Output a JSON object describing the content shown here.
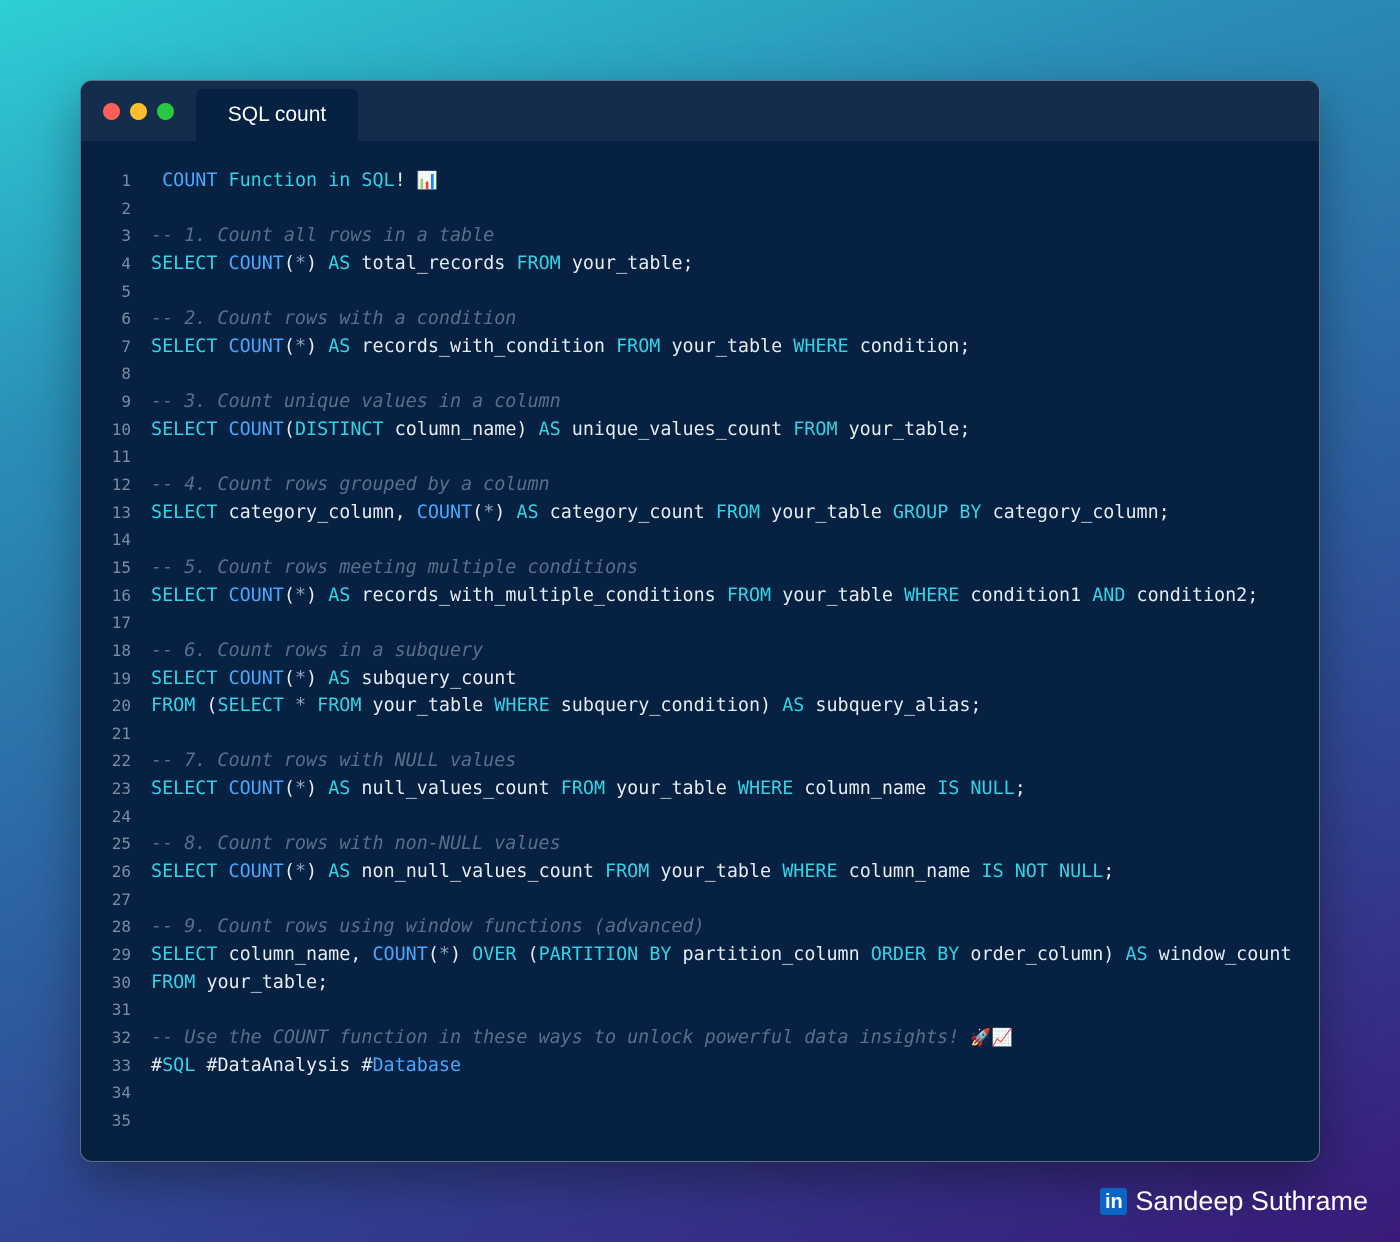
{
  "window": {
    "tab_title": "SQL count",
    "controls": [
      "close",
      "minimize",
      "zoom"
    ]
  },
  "colors": {
    "keyword": "#34d3e6",
    "function": "#4aa8ff",
    "comment": "#58708c",
    "identifier": "#e6edf3",
    "operator": "#8ea1b8",
    "editor_bg": "#072142",
    "titlebar_bg": "#142d4d"
  },
  "code": {
    "lines": [
      {
        "n": "1",
        "tokens": [
          {
            "t": " ",
            "c": "id"
          },
          {
            "t": "COUNT",
            "c": "fn"
          },
          {
            "t": " Function in SQL",
            "c": "kw"
          },
          {
            "t": "! ",
            "c": "id"
          },
          {
            "t": "📊",
            "c": "emoji"
          }
        ]
      },
      {
        "n": "2",
        "tokens": []
      },
      {
        "n": "3",
        "tokens": [
          {
            "t": "-- 1. Count all rows in a table",
            "c": "cm"
          }
        ]
      },
      {
        "n": "4",
        "tokens": [
          {
            "t": "SELECT ",
            "c": "kw"
          },
          {
            "t": "COUNT",
            "c": "fn"
          },
          {
            "t": "(",
            "c": "id"
          },
          {
            "t": "*",
            "c": "op"
          },
          {
            "t": ") ",
            "c": "id"
          },
          {
            "t": "AS ",
            "c": "kw"
          },
          {
            "t": "total_records ",
            "c": "id"
          },
          {
            "t": "FROM ",
            "c": "kw"
          },
          {
            "t": "your_table;",
            "c": "id"
          }
        ]
      },
      {
        "n": "5",
        "tokens": []
      },
      {
        "n": "6",
        "tokens": [
          {
            "t": "-- 2. Count rows with a condition",
            "c": "cm"
          }
        ]
      },
      {
        "n": "7",
        "tokens": [
          {
            "t": "SELECT ",
            "c": "kw"
          },
          {
            "t": "COUNT",
            "c": "fn"
          },
          {
            "t": "(",
            "c": "id"
          },
          {
            "t": "*",
            "c": "op"
          },
          {
            "t": ") ",
            "c": "id"
          },
          {
            "t": "AS ",
            "c": "kw"
          },
          {
            "t": "records_with_condition ",
            "c": "id"
          },
          {
            "t": "FROM ",
            "c": "kw"
          },
          {
            "t": "your_table ",
            "c": "id"
          },
          {
            "t": "WHERE ",
            "c": "kw"
          },
          {
            "t": "condition;",
            "c": "id"
          }
        ]
      },
      {
        "n": "8",
        "tokens": []
      },
      {
        "n": "9",
        "tokens": [
          {
            "t": "-- 3. Count unique values in a column",
            "c": "cm"
          }
        ]
      },
      {
        "n": "10",
        "tokens": [
          {
            "t": "SELECT ",
            "c": "kw"
          },
          {
            "t": "COUNT",
            "c": "fn"
          },
          {
            "t": "(",
            "c": "id"
          },
          {
            "t": "DISTINCT ",
            "c": "kw"
          },
          {
            "t": "column_name) ",
            "c": "id"
          },
          {
            "t": "AS ",
            "c": "kw"
          },
          {
            "t": "unique_values_count ",
            "c": "id"
          },
          {
            "t": "FROM ",
            "c": "kw"
          },
          {
            "t": "your_table;",
            "c": "id"
          }
        ]
      },
      {
        "n": "11",
        "tokens": []
      },
      {
        "n": "12",
        "tokens": [
          {
            "t": "-- 4. Count rows grouped by a column",
            "c": "cm"
          }
        ]
      },
      {
        "n": "13",
        "tokens": [
          {
            "t": "SELECT ",
            "c": "kw"
          },
          {
            "t": "category_column, ",
            "c": "id"
          },
          {
            "t": "COUNT",
            "c": "fn"
          },
          {
            "t": "(",
            "c": "id"
          },
          {
            "t": "*",
            "c": "op"
          },
          {
            "t": ") ",
            "c": "id"
          },
          {
            "t": "AS ",
            "c": "kw"
          },
          {
            "t": "category_count ",
            "c": "id"
          },
          {
            "t": "FROM ",
            "c": "kw"
          },
          {
            "t": "your_table ",
            "c": "id"
          },
          {
            "t": "GROUP BY ",
            "c": "kw"
          },
          {
            "t": "category_column;",
            "c": "id"
          }
        ]
      },
      {
        "n": "14",
        "tokens": []
      },
      {
        "n": "15",
        "tokens": [
          {
            "t": "-- 5. Count rows meeting multiple conditions",
            "c": "cm"
          }
        ]
      },
      {
        "n": "16",
        "tokens": [
          {
            "t": "SELECT ",
            "c": "kw"
          },
          {
            "t": "COUNT",
            "c": "fn"
          },
          {
            "t": "(",
            "c": "id"
          },
          {
            "t": "*",
            "c": "op"
          },
          {
            "t": ") ",
            "c": "id"
          },
          {
            "t": "AS ",
            "c": "kw"
          },
          {
            "t": "records_with_multiple_conditions ",
            "c": "id"
          },
          {
            "t": "FROM ",
            "c": "kw"
          },
          {
            "t": "your_table ",
            "c": "id"
          },
          {
            "t": "WHERE ",
            "c": "kw"
          },
          {
            "t": "condition1 ",
            "c": "id"
          },
          {
            "t": "AND ",
            "c": "kw"
          },
          {
            "t": "condition2;",
            "c": "id"
          }
        ]
      },
      {
        "n": "17",
        "tokens": []
      },
      {
        "n": "18",
        "tokens": [
          {
            "t": "-- 6. Count rows in a subquery",
            "c": "cm"
          }
        ]
      },
      {
        "n": "19",
        "tokens": [
          {
            "t": "SELECT ",
            "c": "kw"
          },
          {
            "t": "COUNT",
            "c": "fn"
          },
          {
            "t": "(",
            "c": "id"
          },
          {
            "t": "*",
            "c": "op"
          },
          {
            "t": ") ",
            "c": "id"
          },
          {
            "t": "AS ",
            "c": "kw"
          },
          {
            "t": "subquery_count",
            "c": "id"
          }
        ]
      },
      {
        "n": "20",
        "tokens": [
          {
            "t": "FROM ",
            "c": "kw"
          },
          {
            "t": "(",
            "c": "id"
          },
          {
            "t": "SELECT ",
            "c": "kw"
          },
          {
            "t": "* ",
            "c": "op"
          },
          {
            "t": "FROM ",
            "c": "kw"
          },
          {
            "t": "your_table ",
            "c": "id"
          },
          {
            "t": "WHERE ",
            "c": "kw"
          },
          {
            "t": "subquery_condition) ",
            "c": "id"
          },
          {
            "t": "AS ",
            "c": "kw"
          },
          {
            "t": "subquery_alias;",
            "c": "id"
          }
        ]
      },
      {
        "n": "21",
        "tokens": []
      },
      {
        "n": "22",
        "tokens": [
          {
            "t": "-- 7. Count rows with NULL values",
            "c": "cm"
          }
        ]
      },
      {
        "n": "23",
        "tokens": [
          {
            "t": "SELECT ",
            "c": "kw"
          },
          {
            "t": "COUNT",
            "c": "fn"
          },
          {
            "t": "(",
            "c": "id"
          },
          {
            "t": "*",
            "c": "op"
          },
          {
            "t": ") ",
            "c": "id"
          },
          {
            "t": "AS ",
            "c": "kw"
          },
          {
            "t": "null_values_count ",
            "c": "id"
          },
          {
            "t": "FROM ",
            "c": "kw"
          },
          {
            "t": "your_table ",
            "c": "id"
          },
          {
            "t": "WHERE ",
            "c": "kw"
          },
          {
            "t": "column_name ",
            "c": "id"
          },
          {
            "t": "IS NULL",
            "c": "kw"
          },
          {
            "t": ";",
            "c": "id"
          }
        ]
      },
      {
        "n": "24",
        "tokens": []
      },
      {
        "n": "25",
        "tokens": [
          {
            "t": "-- 8. Count rows with non-NULL values",
            "c": "cm"
          }
        ]
      },
      {
        "n": "26",
        "tokens": [
          {
            "t": "SELECT ",
            "c": "kw"
          },
          {
            "t": "COUNT",
            "c": "fn"
          },
          {
            "t": "(",
            "c": "id"
          },
          {
            "t": "*",
            "c": "op"
          },
          {
            "t": ") ",
            "c": "id"
          },
          {
            "t": "AS ",
            "c": "kw"
          },
          {
            "t": "non_null_values_count ",
            "c": "id"
          },
          {
            "t": "FROM ",
            "c": "kw"
          },
          {
            "t": "your_table ",
            "c": "id"
          },
          {
            "t": "WHERE ",
            "c": "kw"
          },
          {
            "t": "column_name ",
            "c": "id"
          },
          {
            "t": "IS NOT NULL",
            "c": "kw"
          },
          {
            "t": ";",
            "c": "id"
          }
        ]
      },
      {
        "n": "27",
        "tokens": []
      },
      {
        "n": "28",
        "tokens": [
          {
            "t": "-- 9. Count rows using window functions (advanced)",
            "c": "cm"
          }
        ]
      },
      {
        "n": "29",
        "tokens": [
          {
            "t": "SELECT ",
            "c": "kw"
          },
          {
            "t": "column_name, ",
            "c": "id"
          },
          {
            "t": "COUNT",
            "c": "fn"
          },
          {
            "t": "(",
            "c": "id"
          },
          {
            "t": "*",
            "c": "op"
          },
          {
            "t": ") ",
            "c": "id"
          },
          {
            "t": "OVER ",
            "c": "kw"
          },
          {
            "t": "(",
            "c": "id"
          },
          {
            "t": "PARTITION BY ",
            "c": "kw"
          },
          {
            "t": "partition_column ",
            "c": "id"
          },
          {
            "t": "ORDER BY ",
            "c": "kw"
          },
          {
            "t": "order_column) ",
            "c": "id"
          },
          {
            "t": "AS ",
            "c": "kw"
          },
          {
            "t": "window_count",
            "c": "id"
          }
        ]
      },
      {
        "n": "30",
        "tokens": [
          {
            "t": "FROM ",
            "c": "kw"
          },
          {
            "t": "your_table;",
            "c": "id"
          }
        ]
      },
      {
        "n": "31",
        "tokens": []
      },
      {
        "n": "32",
        "tokens": [
          {
            "t": "-- Use the COUNT function in these ways to unlock powerful data insights! ",
            "c": "cm"
          },
          {
            "t": "🚀📈",
            "c": "emoji"
          }
        ]
      },
      {
        "n": "33",
        "tokens": [
          {
            "t": "#",
            "c": "id"
          },
          {
            "t": "SQL ",
            "c": "kw"
          },
          {
            "t": "#DataAnalysis #",
            "c": "id"
          },
          {
            "t": "Database",
            "c": "fn"
          }
        ]
      },
      {
        "n": "34",
        "tokens": []
      },
      {
        "n": "35",
        "tokens": []
      }
    ]
  },
  "credit": {
    "logo": "linkedin-logo",
    "logo_text": "in",
    "author": "Sandeep Suthrame"
  }
}
